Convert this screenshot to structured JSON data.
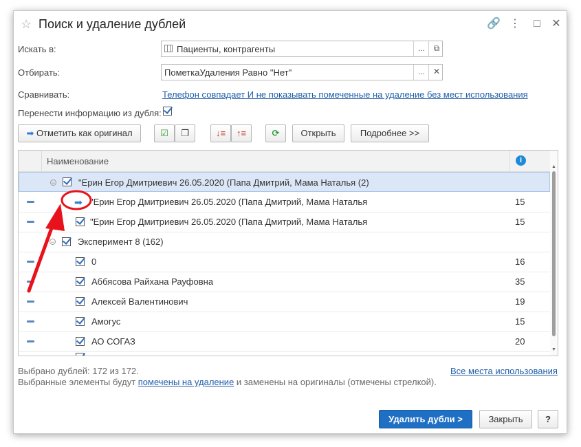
{
  "window": {
    "title": "Поиск и удаление дублей"
  },
  "form": {
    "search_in": {
      "label": "Искать в:",
      "value": "Пациенты, контрагенты"
    },
    "filter": {
      "label": "Отбирать:",
      "value": "ПометкаУдаления Равно \"Нет\""
    },
    "compare": {
      "label": "Сравнивать:",
      "link": "Телефон совпадает И не показывать помеченные на удаление без мест использования"
    },
    "transfer": {
      "label": "Перенести информацию из дубля:",
      "checked": true
    }
  },
  "toolbar": {
    "mark_original": "Отметить как оригинал",
    "open": "Открыть",
    "more": "Подробнее >>"
  },
  "grid": {
    "header_name": "Наименование",
    "header_info_icon": "info-icon",
    "rows": [
      {
        "type": "group",
        "name": "\"Ерин Егор Дмитриевич  26.05.2020 (Папа Дмитрий, Мама Наталья (2)",
        "count": ""
      },
      {
        "type": "original",
        "name": "\"Ерин Егор Дмитриевич  26.05.2020 (Папа Дмитрий, Мама Наталья",
        "count": "15"
      },
      {
        "type": "item",
        "name": "\"Ерин Егор Дмитриевич  26.05.2020 (Папа Дмитрий, Мама Наталья",
        "count": "15"
      },
      {
        "type": "group",
        "name": "Эксперимент 8  (162)",
        "count": ""
      },
      {
        "type": "item",
        "name": "0",
        "count": "16"
      },
      {
        "type": "item",
        "name": "Аббясова Райхана Рауфовна",
        "count": "35"
      },
      {
        "type": "item",
        "name": "Алексей Валентинович",
        "count": "19"
      },
      {
        "type": "item",
        "name": "Амогус",
        "count": "15"
      },
      {
        "type": "item",
        "name": "АО СОГАЗ",
        "count": "20"
      }
    ]
  },
  "footer": {
    "selected": "Выбрано дублей: 172 из 172.",
    "all_usage_link": "Все места использования",
    "note_prefix": "Выбранные элементы будут ",
    "note_link": "помечены на удаление",
    "note_suffix": " и заменены на оригиналы (отмечены стрелкой)."
  },
  "buttons": {
    "delete": "Удалить дубли >",
    "close": "Закрыть",
    "help": "?"
  },
  "colors": {
    "accent": "#1f6fc5",
    "annotation": "#e8121c"
  }
}
